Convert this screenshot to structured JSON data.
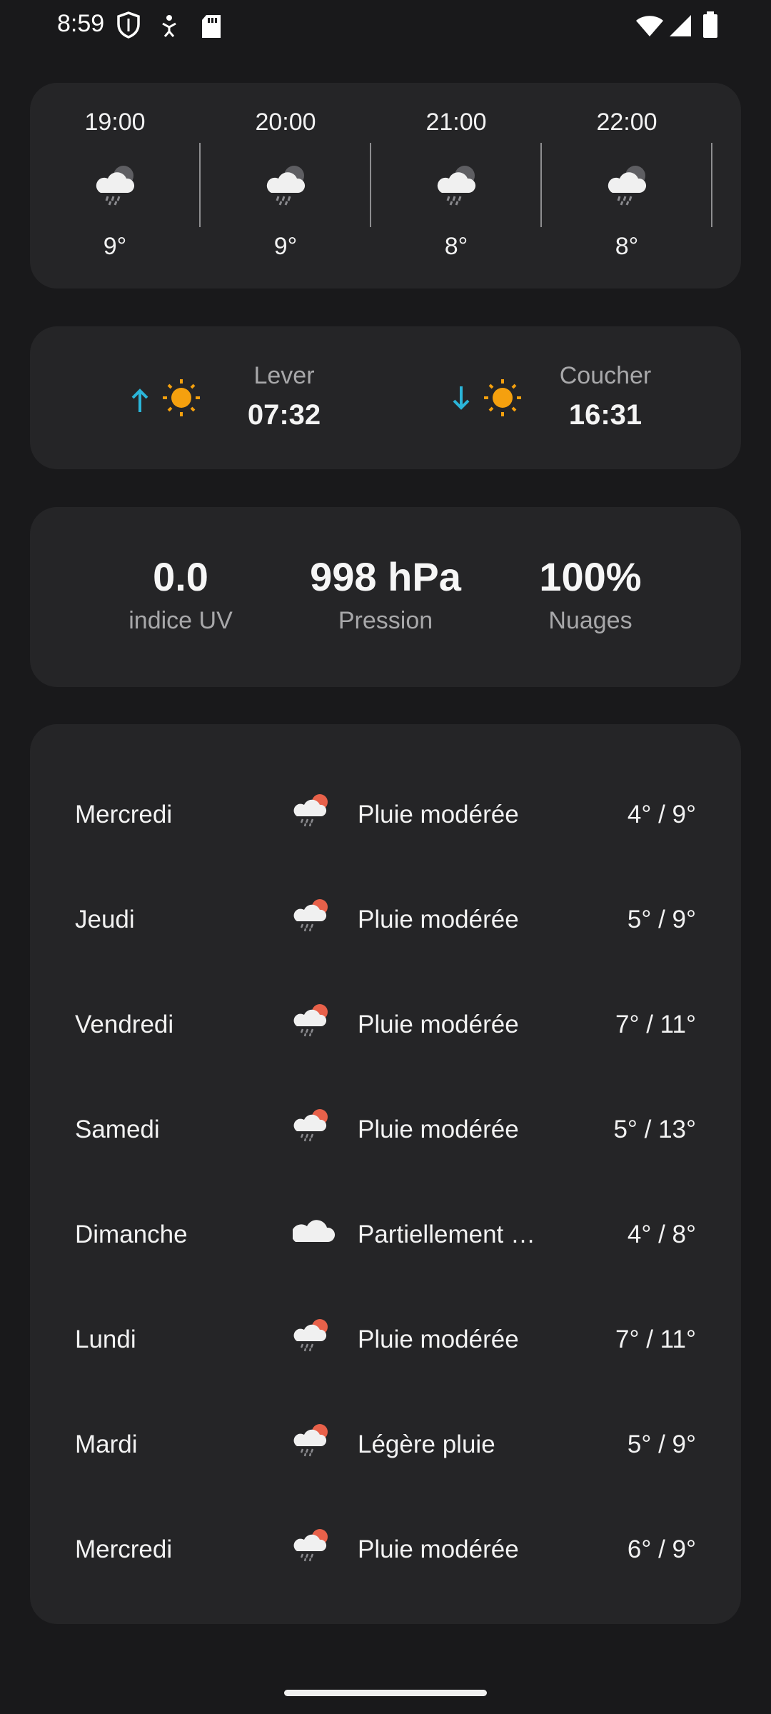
{
  "status_bar": {
    "time": "8:59",
    "left_icons": [
      "shield-icon",
      "accessibility-icon",
      "sd-card-icon"
    ],
    "right_icons": [
      "wifi-icon",
      "signal-icon",
      "battery-icon"
    ]
  },
  "hourly": [
    {
      "time": "19:00",
      "icon": "rain-cloud-icon",
      "temp": "9°"
    },
    {
      "time": "20:00",
      "icon": "rain-cloud-icon",
      "temp": "9°"
    },
    {
      "time": "21:00",
      "icon": "rain-cloud-icon",
      "temp": "8°"
    },
    {
      "time": "22:00",
      "icon": "rain-cloud-icon",
      "temp": "8°"
    }
  ],
  "sun": {
    "sunrise": {
      "label": "Lever",
      "value": "07:32",
      "icon": "sunrise-icon"
    },
    "sunset": {
      "label": "Coucher",
      "value": "16:31",
      "icon": "sunset-icon"
    }
  },
  "stats": [
    {
      "value": "0.0",
      "label": "indice UV"
    },
    {
      "value": "998 hPa",
      "label": "Pression"
    },
    {
      "value": "100%",
      "label": "Nuages"
    }
  ],
  "daily": [
    {
      "day": "Mercredi",
      "icon": "rain-sun-icon",
      "desc": "Pluie modérée",
      "temp": "4° / 9°"
    },
    {
      "day": "Jeudi",
      "icon": "rain-sun-icon",
      "desc": "Pluie modérée",
      "temp": "5° / 9°"
    },
    {
      "day": "Vendredi",
      "icon": "rain-sun-icon",
      "desc": "Pluie modérée",
      "temp": "7° / 11°"
    },
    {
      "day": "Samedi",
      "icon": "rain-sun-icon",
      "desc": "Pluie modérée",
      "temp": "5° / 13°"
    },
    {
      "day": "Dimanche",
      "icon": "cloud-icon",
      "desc": "Partiellement …",
      "temp": "4° / 8°"
    },
    {
      "day": "Lundi",
      "icon": "rain-sun-icon",
      "desc": "Pluie modérée",
      "temp": "7° / 11°"
    },
    {
      "day": "Mardi",
      "icon": "rain-sun-icon",
      "desc": "Légère pluie",
      "temp": "5° / 9°"
    },
    {
      "day": "Mercredi",
      "icon": "rain-sun-icon",
      "desc": "Pluie modérée",
      "temp": "6° / 9°"
    }
  ],
  "colors": {
    "background": "#19191b",
    "card": "#252527",
    "accent_sun": "#f5a00e",
    "accent_arrow": "#2bb5d9",
    "secondary_text": "#a8a8aa"
  }
}
